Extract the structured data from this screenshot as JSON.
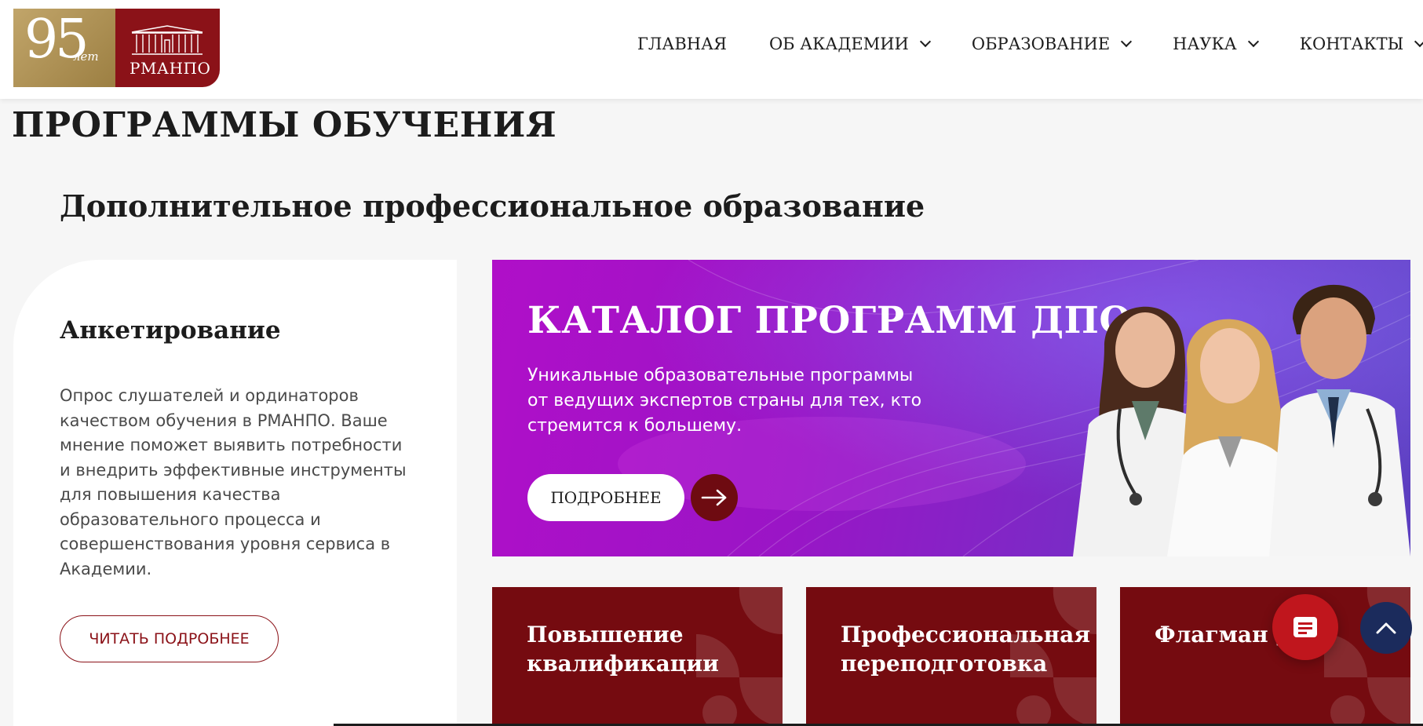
{
  "logo": {
    "years": "95",
    "years_suffix": "лет",
    "name": "РМАНПО",
    "colors": {
      "gold": "#b3955a",
      "burgundy": "#8b1218"
    }
  },
  "nav": {
    "items": [
      {
        "label": "ГЛАВНАЯ",
        "has_dropdown": false
      },
      {
        "label": "ОБ АКАДЕМИИ",
        "has_dropdown": true
      },
      {
        "label": "ОБРАЗОВАНИЕ",
        "has_dropdown": true
      },
      {
        "label": "НАУКА",
        "has_dropdown": true
      },
      {
        "label": "КОНТАКТЫ",
        "has_dropdown": true
      }
    ]
  },
  "page": {
    "title": "ПРОГРАММЫ ОБУЧЕНИЯ",
    "section_title": "Дополнительное профессиональное образование"
  },
  "survey": {
    "title": "Анкетирование",
    "text": "Опрос слушателей и ординаторов качеством обучения в РМАНПО. Ваше мнение поможет выявить потребности и внедрить эффективные инструменты для повышения качества образовательного процесса и совершенствования уровня сервиса в Академии.",
    "button_label": "ЧИТАТЬ ПОДРОБНЕЕ"
  },
  "banner": {
    "title": "КАТАЛОГ ПРОГРАММ ДПО",
    "text": "Уникальные образовательные программы от ведущих экспертов страны для тех, кто стремится к большему.",
    "button_label": "ПОДРОБНЕЕ",
    "arrow_icon": "arrow-right-icon"
  },
  "categories": [
    {
      "title_line1": "Повышение",
      "title_line2": "квалификации"
    },
    {
      "title_line1": "Профессиональная",
      "title_line2": "переподготовка"
    },
    {
      "title_line1": "Флагман Д",
      "title_line2": ""
    }
  ],
  "floating": {
    "chat_icon": "chat-icon",
    "up_icon": "chevron-up-icon"
  },
  "colors": {
    "accent": "#8b1218",
    "card_bg": "#750b10",
    "chat_button": "#c0161d",
    "up_button": "#1b2b5c",
    "banner_start": "#b00fc8",
    "banner_end": "#5b3fc0"
  }
}
